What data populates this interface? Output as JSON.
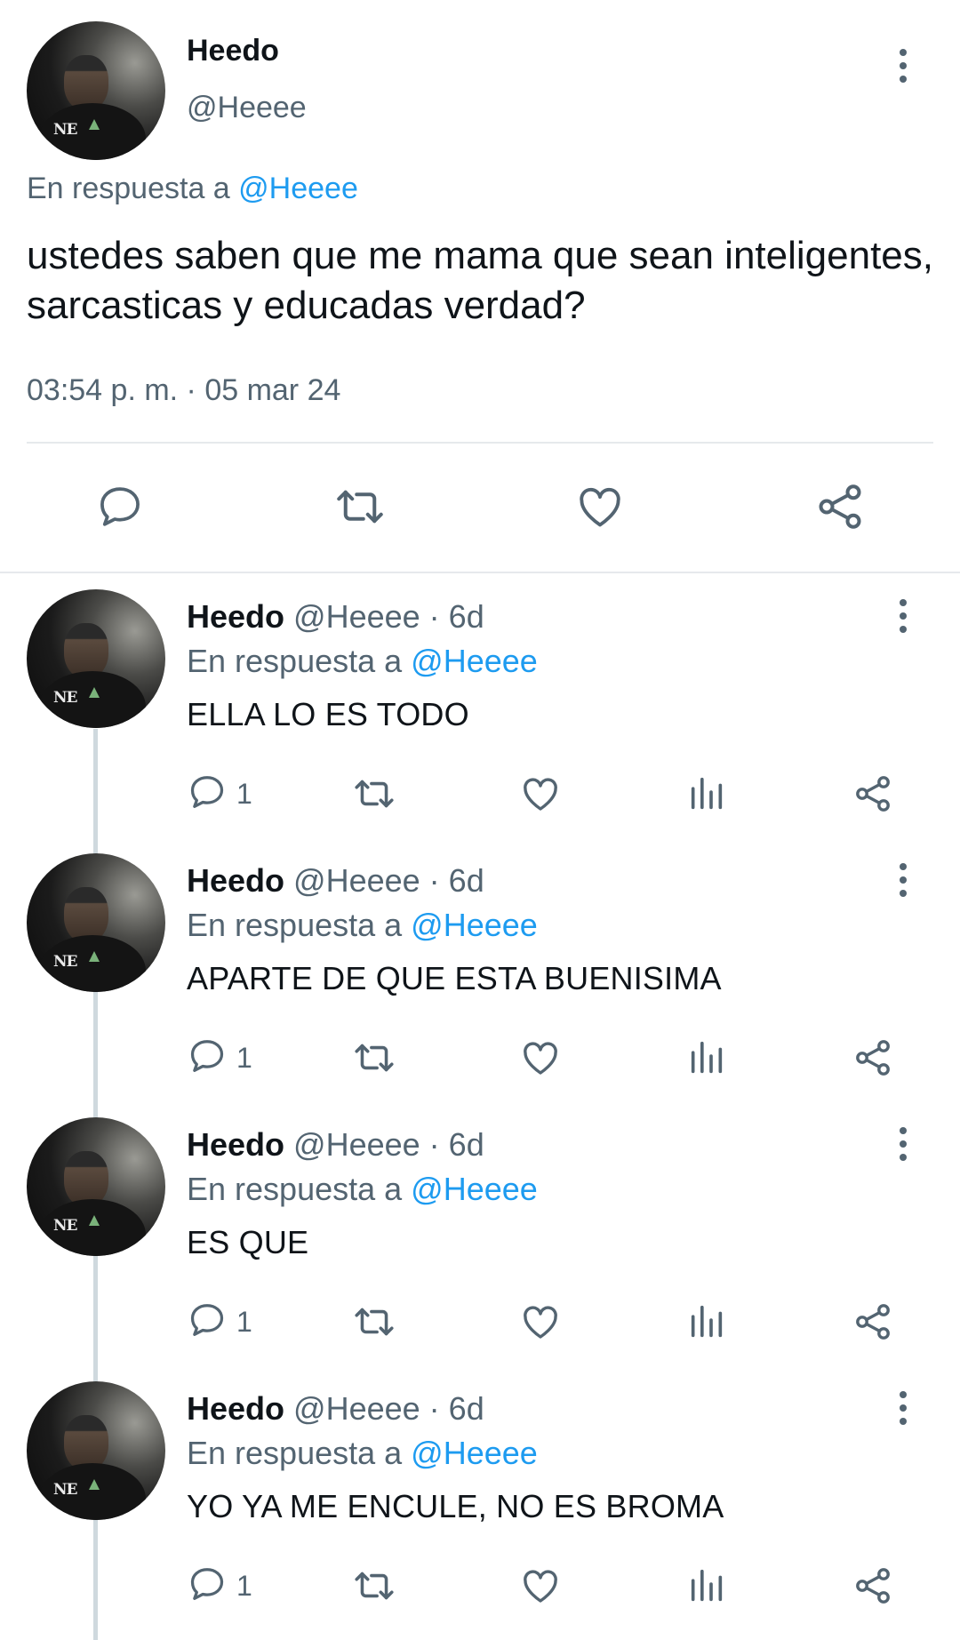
{
  "main_tweet": {
    "name": "Heedo",
    "handle": "@Heeee",
    "reply_prefix": "En respuesta a",
    "reply_mention": "@Heeee",
    "text": "ustedes saben que me mama que sean inteligentes, sarcasticas y educadas verdad?",
    "timestamp": "03:54 p. m. · 05 mar 24",
    "avatar_logo_text": "NE",
    "actions": [
      "reply-icon",
      "retweet-icon",
      "like-icon",
      "share-icon"
    ]
  },
  "replies": [
    {
      "name": "Heedo",
      "handle_time": "@Heeee · 6d",
      "reply_prefix": "En respuesta a",
      "reply_mention": "@Heeee",
      "text": "ELLA LO ES TODO",
      "reply_count": "1"
    },
    {
      "name": "Heedo",
      "handle_time": "@Heeee · 6d",
      "reply_prefix": "En respuesta a",
      "reply_mention": "@Heeee",
      "text": "APARTE DE QUE ESTA BUENISIMA",
      "reply_count": "1"
    },
    {
      "name": "Heedo",
      "handle_time": "@Heeee · 6d",
      "reply_prefix": "En respuesta a",
      "reply_mention": "@Heeee",
      "text": "ES QUE",
      "reply_count": "1"
    },
    {
      "name": "Heedo",
      "handle_time": "@Heeee · 6d",
      "reply_prefix": "En respuesta a",
      "reply_mention": "@Heeee",
      "text": "YO YA ME ENCULE, NO ES BROMA",
      "reply_count": "1"
    }
  ],
  "colors": {
    "text": "#0f1419",
    "muted": "#536471",
    "link": "#1d9bf0",
    "divider": "#e6e9ec",
    "thread_line": "#cfd9de"
  }
}
